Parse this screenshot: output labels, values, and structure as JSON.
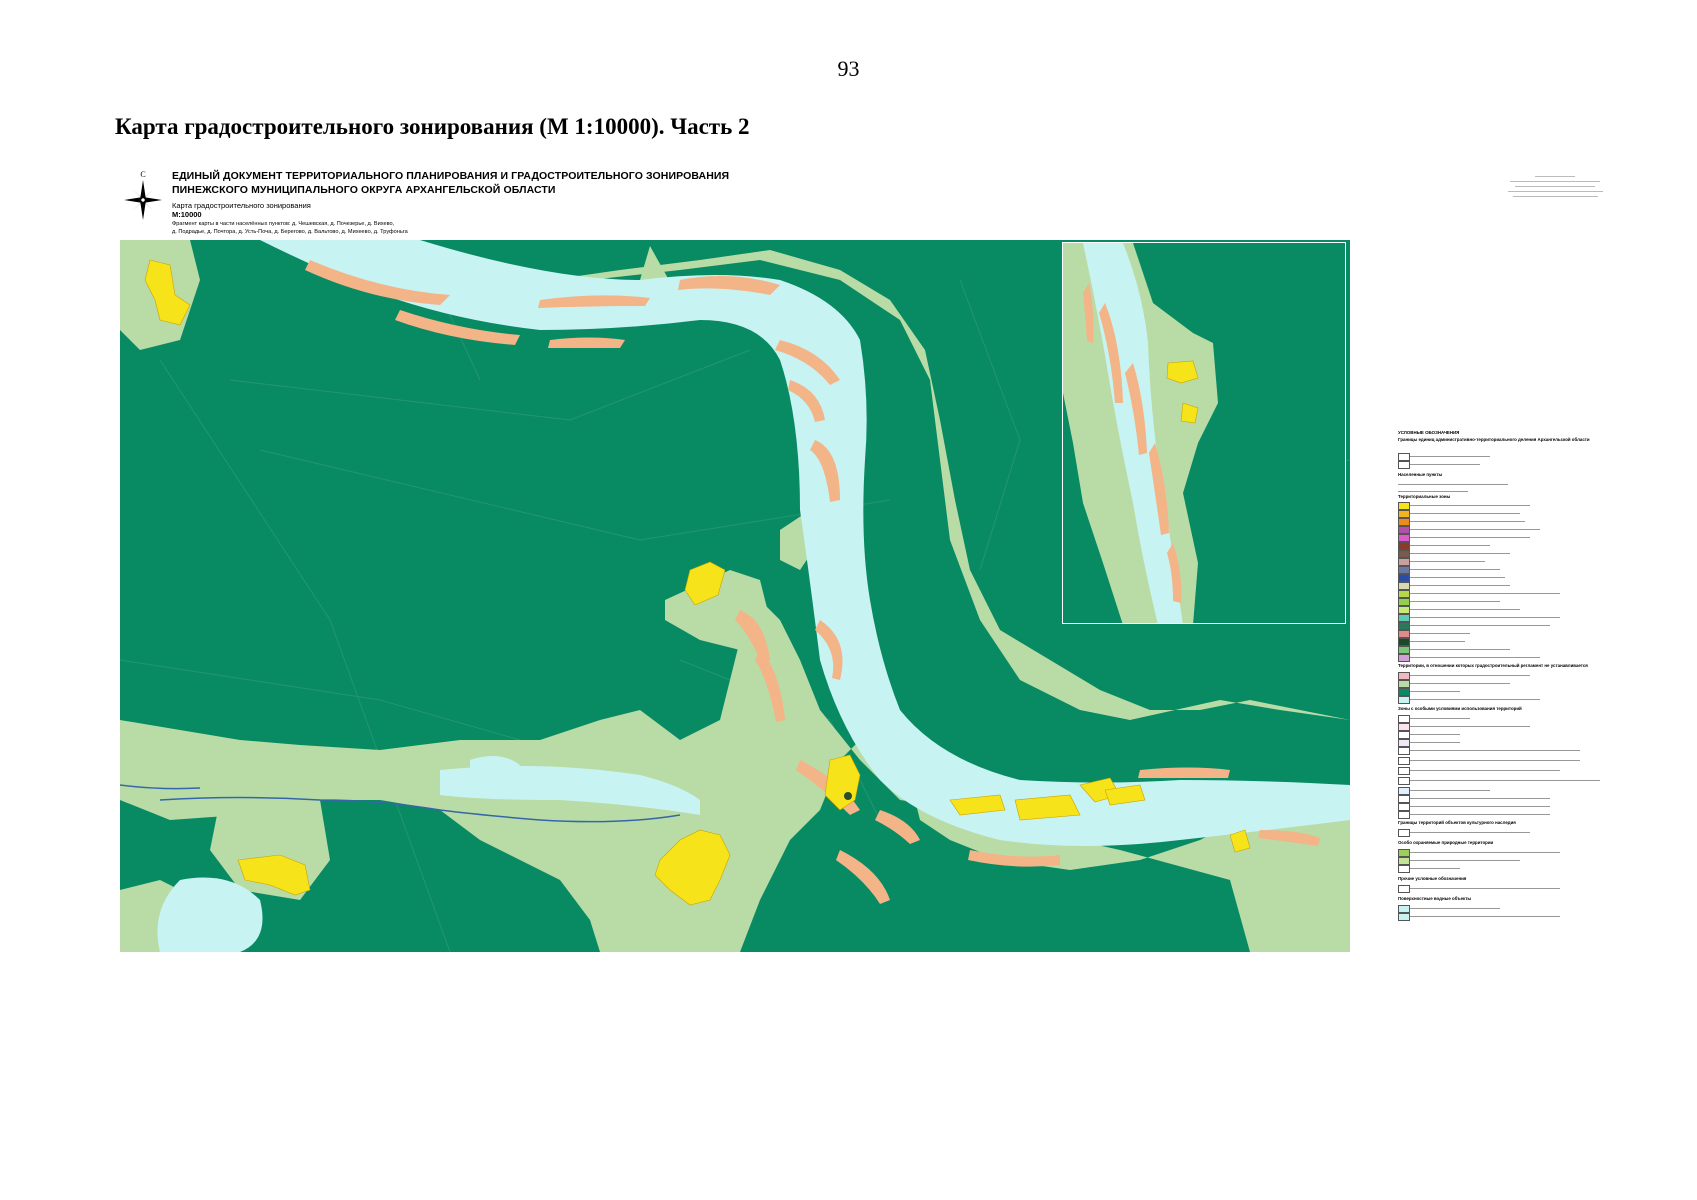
{
  "page_number": "93",
  "heading": "Карта градостроительного зонирования (М 1:10000). Часть 2",
  "map_header": {
    "north_label": "С",
    "title_line1": "ЕДИНЫЙ ДОКУМЕНТ ТЕРРИТОРИАЛЬНОГО ПЛАНИРОВАНИЯ И ГРАДОСТРОИТЕЛЬНОГО ЗОНИРОВАНИЯ",
    "title_line2": "ПИНЕЖСКОГО МУНИЦИПАЛЬНОГО ОКРУГА  АРХАНГЕЛЬСКОЙ ОБЛАСТИ",
    "map_name": "Карта градостроительного зонирования",
    "scale": "М:10000",
    "fragment_line1": "Фрагмент карты в части населённых пунктов: д. Чешевская, д. Почезерье, д. Вихево,",
    "fragment_line2": "д. Подрадье, д. Почтора, д. Усть-Поча, д. Берегово, д. Вальтово, д. Михеево, д. Труфоньга"
  },
  "legend": {
    "title": "УСЛОВНЫЕ ОБОЗНАЧЕНИЯ",
    "section_boundaries": "Границы единиц административно-территориального деления Архангельской области",
    "section_settlements": "Населенные пункты",
    "section_zones": "Территориальные зоны",
    "section_no_regulations": "Территории, в отношении которых градостроительный регламент не устанавливается",
    "section_special_zones": "Зоны с особыми условиями использования территорий",
    "section_heritage": "Границы территорий объектов культурного наследия",
    "section_protected": "Особо охраняемые природные территории",
    "section_other": "Прочие условные обозначения",
    "section_water": "Поверхностные водные объекты"
  },
  "colors": {
    "forest": "#088a63",
    "agri": "#b9dca7",
    "water": "#c7f3f3",
    "sandbar": "#f3b488",
    "settlement": "#f6e31a",
    "river_line": "#3566a8",
    "grid_line": "#2a9a70"
  },
  "icons": [
    "north-arrow-icon"
  ]
}
